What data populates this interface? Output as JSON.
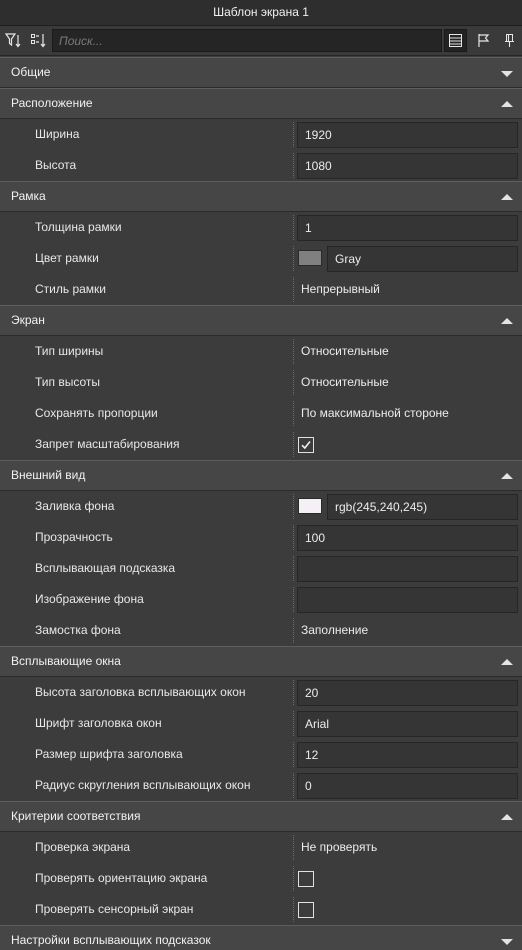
{
  "window": {
    "title": "Шаблон экрана 1"
  },
  "toolbar": {
    "filter_icon": "filter-sort-icon",
    "categorize_icon": "categorize-sort-icon",
    "search_placeholder": "Поиск...",
    "properties_icon": "properties-list-icon",
    "events_icon": "flag-icon",
    "pin_icon": "pin-icon"
  },
  "sections": {
    "general": {
      "title": "Общие",
      "collapsed": true
    },
    "location": {
      "title": "Расположение",
      "width_label": "Ширина",
      "width_value": "1920",
      "height_label": "Высота",
      "height_value": "1080"
    },
    "frame": {
      "title": "Рамка",
      "thickness_label": "Толщина рамки",
      "thickness_value": "1",
      "color_label": "Цвет рамки",
      "color_value": "Gray",
      "color_swatch": "#808080",
      "style_label": "Стиль рамки",
      "style_value": "Непрерывный"
    },
    "screen": {
      "title": "Экран",
      "width_type_label": "Тип ширины",
      "width_type_value": "Относительные",
      "height_type_label": "Тип высоты",
      "height_type_value": "Относительные",
      "keep_ratio_label": "Сохранять пропорции",
      "keep_ratio_value": "По максимальной стороне",
      "no_scale_label": "Запрет масштабирования",
      "no_scale_checked": true
    },
    "appearance": {
      "title": "Внешний вид",
      "fill_label": "Заливка фона",
      "fill_value": "rgb(245,240,245)",
      "fill_swatch": "#f5f0f5",
      "opacity_label": "Прозрачность",
      "opacity_value": "100",
      "tooltip_label": "Всплывающая подсказка",
      "tooltip_value": "",
      "bg_image_label": "Изображение фона",
      "bg_image_value": "",
      "tiling_label": "Замостка фона",
      "tiling_value": "Заполнение"
    },
    "popups": {
      "title": "Всплывающие окна",
      "header_height_label": "Высота заголовка всплывающих окон",
      "header_height_value": "20",
      "header_font_label": "Шрифт заголовка окон",
      "header_font_value": "Arial",
      "header_font_size_label": "Размер шрифта заголовка",
      "header_font_size_value": "12",
      "corner_radius_label": "Радиус скругления всплывающих окон",
      "corner_radius_value": "0"
    },
    "criteria": {
      "title": "Критерии соответствия",
      "screen_check_label": "Проверка экрана",
      "screen_check_value": "Не проверять",
      "orientation_label": "Проверять ориентацию экрана",
      "orientation_checked": false,
      "touch_label": "Проверять сенсорный экран",
      "touch_checked": false
    },
    "tooltip_settings": {
      "title": "Настройки всплывающих подсказок",
      "collapsed": true
    }
  }
}
